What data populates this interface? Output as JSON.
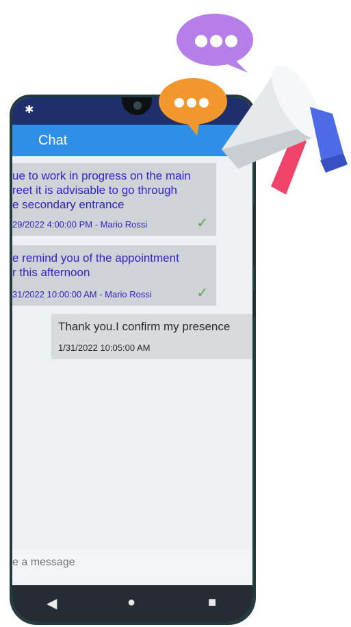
{
  "app": {
    "title": "Chat"
  },
  "status": {
    "settings_icon": "gear-icon"
  },
  "messages": [
    {
      "direction": "incoming",
      "text": "ue to work in progress on the main\nreet it is advisable to go through\ne secondary entrance",
      "meta": "29/2022 4:00:00 PM - Mario Rossi",
      "status_icon": "checkmark-icon"
    },
    {
      "direction": "incoming",
      "text": "e remind you of the appointment\nr this afternoon",
      "meta": "31/2022 10:00:00 AM - Mario Rossi",
      "status_icon": "checkmark-icon"
    },
    {
      "direction": "outgoing",
      "text": "Thank you.I confirm my presence",
      "meta": "1/31/2022 10:05:00 AM"
    }
  ],
  "composer": {
    "placeholder": "e a message"
  },
  "navbar": {
    "back": "◀",
    "home": "●",
    "recents": "■"
  },
  "colors": {
    "appbar": "#2f8fe6",
    "incoming_text": "#2e24c9",
    "incoming_bubble": "#cfd2d6",
    "check": "#5aa85a",
    "bubble_purple": "#b57ee8",
    "bubble_orange": "#f2962e",
    "megaphone_handle": "#4d6be6",
    "megaphone_grip": "#f0436a"
  }
}
